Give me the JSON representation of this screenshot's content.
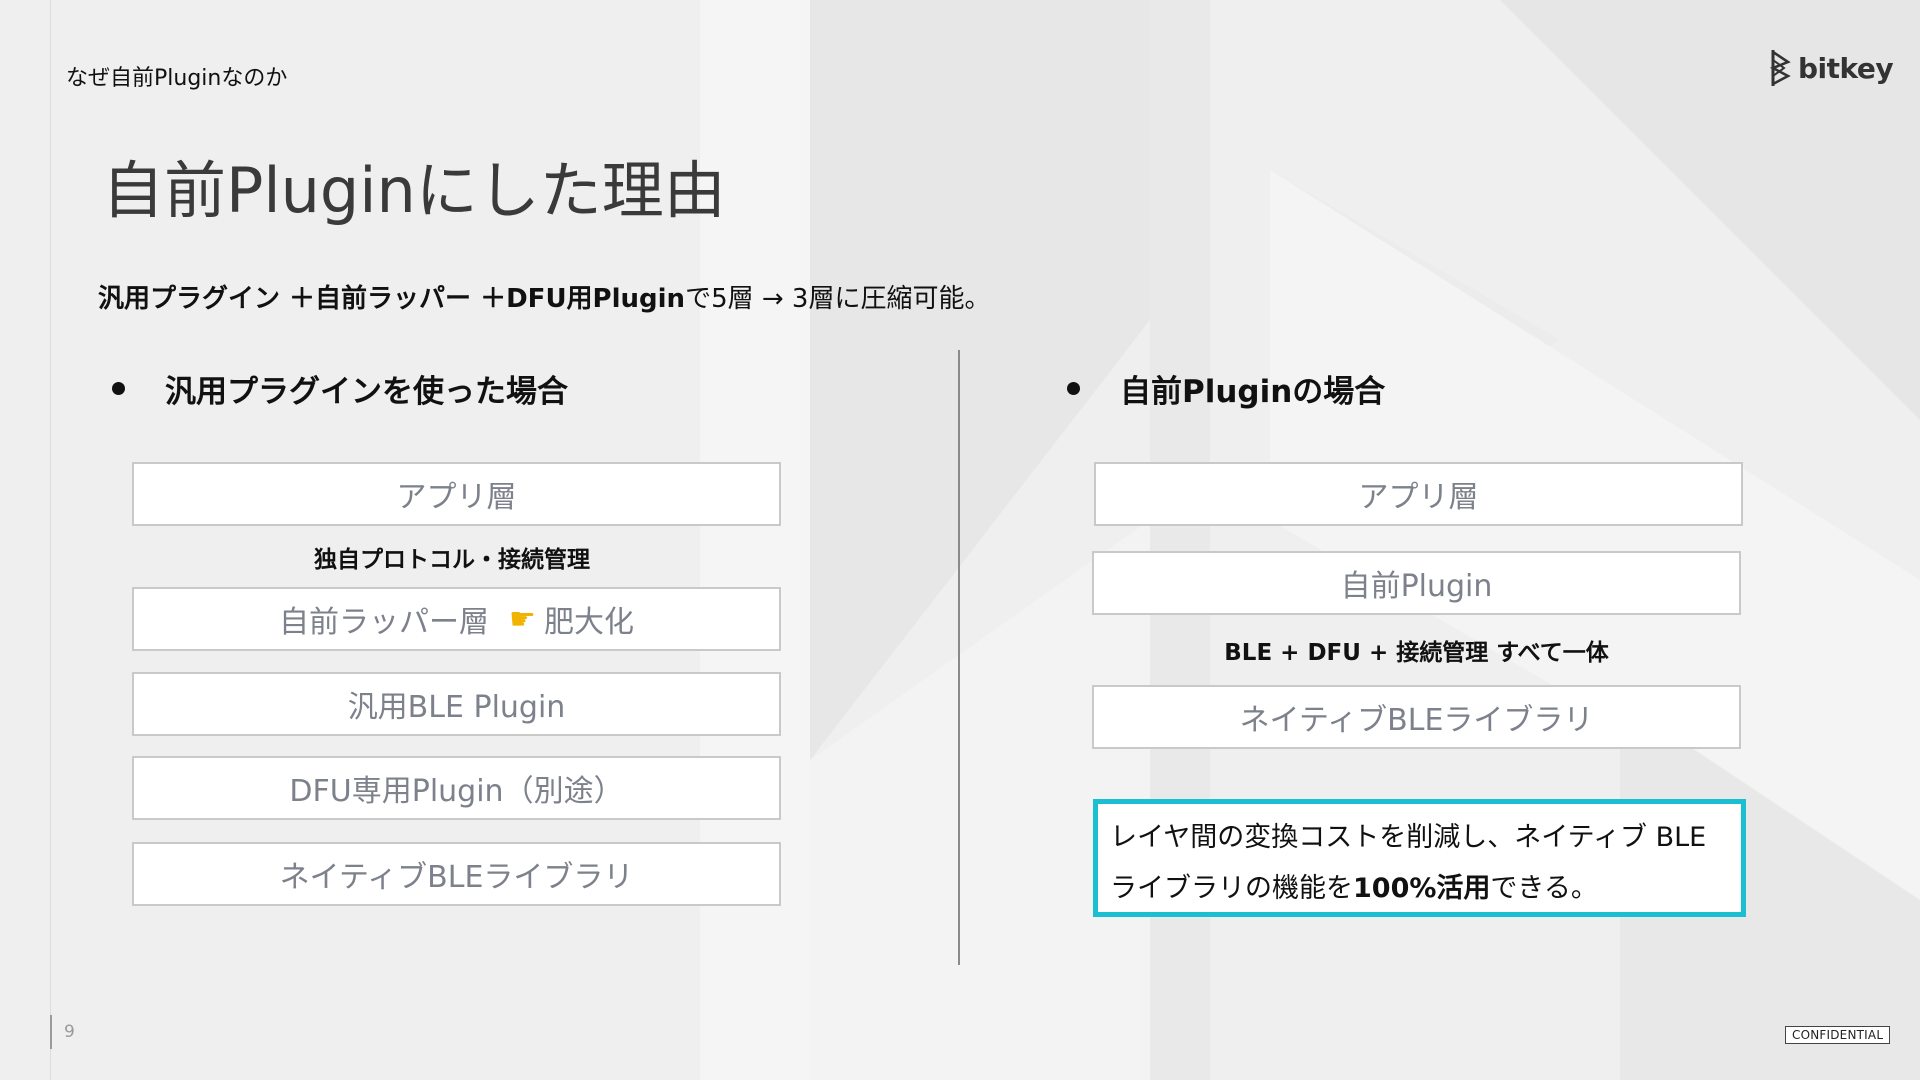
{
  "header": {
    "section_label": "なぜ自前Pluginなのか",
    "logo_text": "bitkey"
  },
  "title": "自前Pluginにした理由",
  "summary": {
    "part1": "汎用プラグイン ＋自前ラッパー ＋DFU用Plugin",
    "part2": "で5層 → 3層に圧縮可能。"
  },
  "left_column": {
    "heading": "汎用プラグインを使った場合",
    "layers": [
      "アプリ層",
      "自前ラッパー層",
      "汎用BLE Plugin",
      "DFU専用Plugin（別途）",
      "ネイティブBLEライブラリ"
    ],
    "note": "独自プロトコル・接続管理",
    "wrapper_flag": "肥大化"
  },
  "right_column": {
    "heading": "自前Pluginの場合",
    "layers": [
      "アプリ層",
      "自前Plugin",
      "ネイティブBLEライブラリ"
    ],
    "note": "BLE + DFU + 接続管理 すべて一体"
  },
  "callout": {
    "text1": "レイヤ間の変換コストを削減し、ネイティブ BLE ライブラリの機能を",
    "bold": "100%活用",
    "text2": "できる。"
  },
  "footer": {
    "page_number": "9",
    "confidential": "CONFIDENTIAL"
  },
  "colors": {
    "callout_border": "#1cbfd2",
    "layer_text": "#7c818b",
    "hand_icon": "#f0b400"
  }
}
